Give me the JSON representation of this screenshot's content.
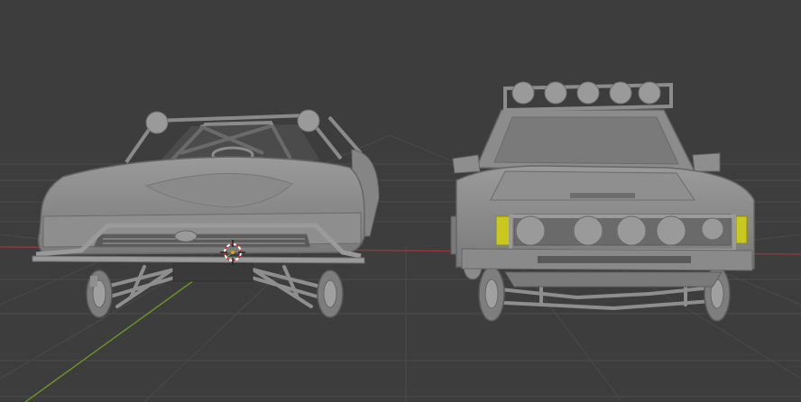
{
  "viewport": {
    "background": "#3d3d3d",
    "grid_color": "#4a4a4a",
    "x_axis_color": "#8a3a3f",
    "y_axis_color": "#6b8f2a"
  },
  "objects": [
    {
      "name": "trophy-truck-model",
      "color": "#8c8c8c",
      "description_icon": "3d-mesh-icon"
    },
    {
      "name": "offroad-pickup-model",
      "color": "#8c8c8c",
      "highlight": "#c8c820",
      "description_icon": "3d-mesh-icon"
    }
  ],
  "cursor_3d": {
    "icon": "3d-cursor-icon",
    "colors": [
      "#ffffff",
      "#d23030"
    ]
  }
}
